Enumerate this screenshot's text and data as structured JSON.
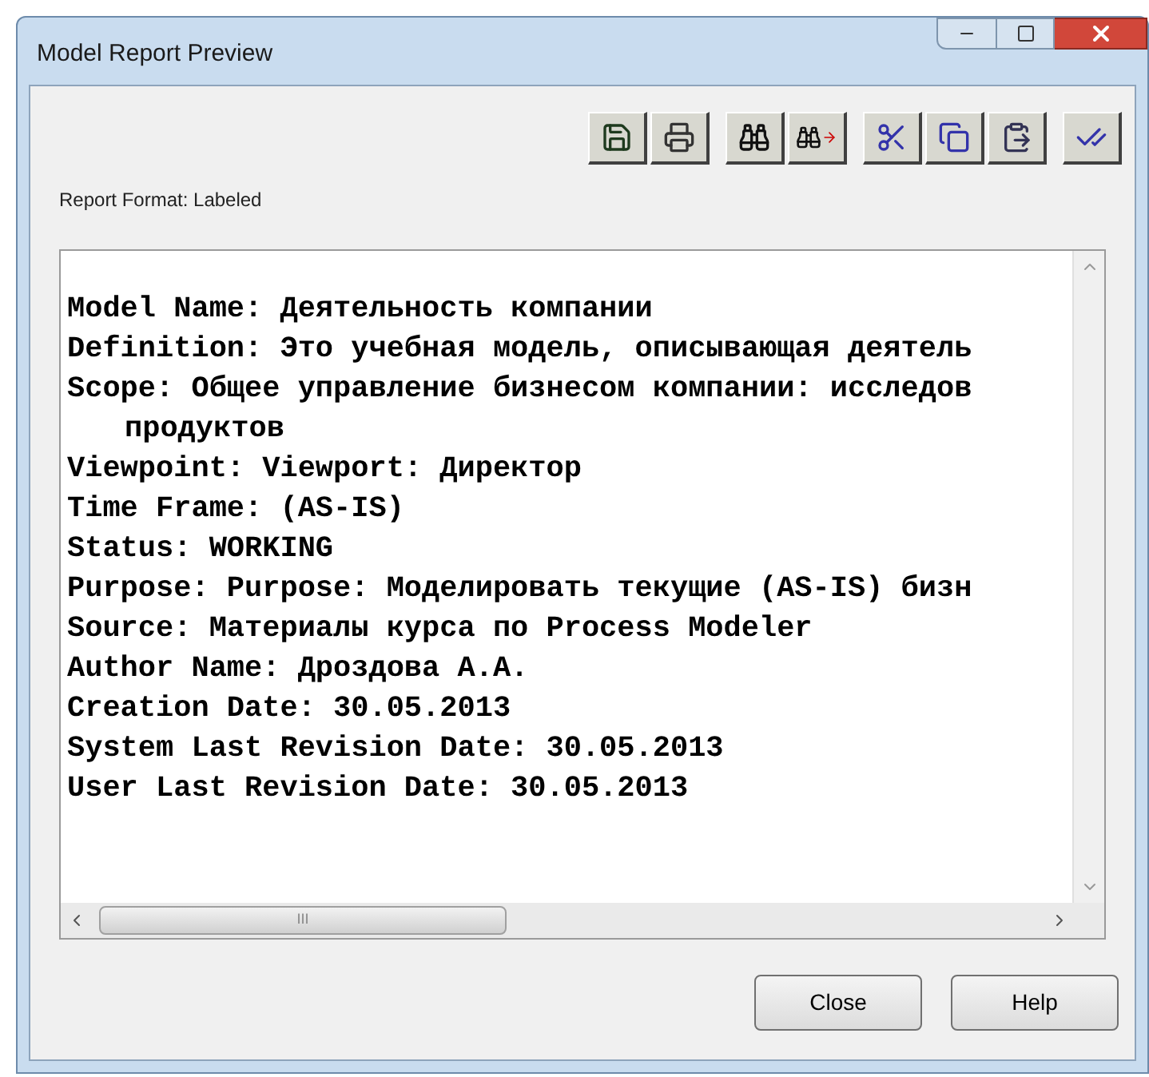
{
  "window": {
    "title": "Model Report Preview"
  },
  "toolbar": [
    {
      "kind": "save"
    },
    {
      "kind": "print"
    },
    {
      "kind": "find",
      "gap": true
    },
    {
      "kind": "find-next"
    },
    {
      "kind": "cut",
      "gap": true
    },
    {
      "kind": "copy"
    },
    {
      "kind": "paste"
    },
    {
      "kind": "spell",
      "gap": true
    }
  ],
  "report_format": "Report Format: Labeled",
  "report_lines": [
    {
      "text": "Model Name: Деятельность компании"
    },
    {
      "text": "Definition: Это учебная модель, описывающая деятель"
    },
    {
      "text": "Scope: Общее управление бизнесом компании: исследов"
    },
    {
      "text": "продуктов",
      "continuation": true
    },
    {
      "text": "Viewpoint: Viewport: Директор"
    },
    {
      "text": "Time Frame: (AS-IS)"
    },
    {
      "text": "Status: WORKING"
    },
    {
      "text": "Purpose: Purpose: Моделировать текущие (AS-IS) бизн"
    },
    {
      "text": "Source: Материалы курса по Process Modeler"
    },
    {
      "text": "Author Name: Дроздова А.А."
    },
    {
      "text": "Creation Date: 30.05.2013"
    },
    {
      "text": "System Last Revision Date: 30.05.2013"
    },
    {
      "text": "User Last Revision Date: 30.05.2013"
    }
  ],
  "scrollbar_grip": "III",
  "buttons": [
    {
      "label": "Close"
    },
    {
      "label": "Help"
    }
  ]
}
